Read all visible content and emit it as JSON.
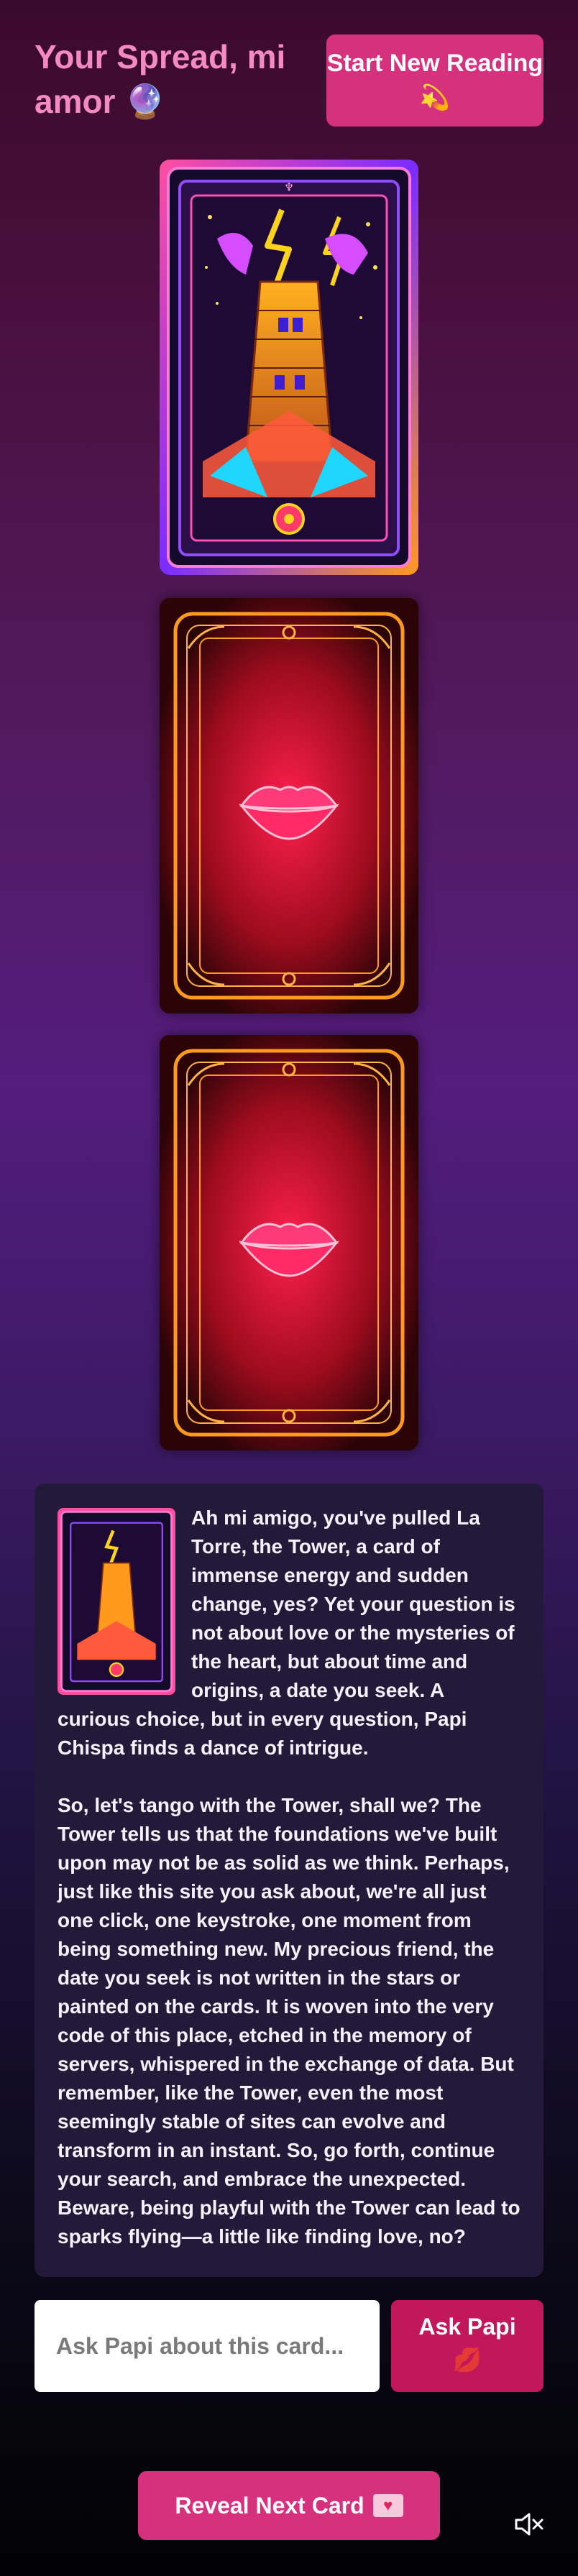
{
  "header": {
    "title": "Your Spread, mi amor 🔮",
    "start_button": "Start New Reading 💫"
  },
  "cards": {
    "face": {
      "name": "La Torre",
      "icon": "tower-card-art"
    },
    "backs": [
      {
        "icon": "lips-card-back"
      },
      {
        "icon": "lips-card-back"
      }
    ]
  },
  "reading": {
    "paragraphs": [
      "Ah mi amigo, you've pulled La Torre, the Tower, a card of immense energy and sudden change, yes? Yet your question is not about love or the mysteries of the heart, but about time and origins, a date you seek. A curious choice, but in every question, Papi Chispa finds a dance of intrigue.",
      "So, let's tango with the Tower, shall we? The Tower tells us that the foundations we've built upon may not be as solid as we think. Perhaps, just like this site you ask about, we're all just one click, one keystroke, one moment from being something new. My precious friend, the date you seek is not written in the stars or painted on the cards. It is woven into the very code of this place, etched in the memory of servers, whispered in the exchange of data. But remember, like the Tower, even the most seemingly stable of sites can evolve and transform in an instant. So, go forth, continue your search, and embrace the unexpected. Beware, being playful with the Tower can lead to sparks flying—a little like finding love, no?"
    ]
  },
  "ask": {
    "placeholder": "Ask Papi about this card...",
    "button_label": "Ask Papi",
    "button_emoji": "💋"
  },
  "reveal": {
    "label": "Reveal Next Card",
    "icon": "love-letter-icon"
  },
  "controls": {
    "mute_icon": "speaker-muted-icon"
  },
  "colors": {
    "accent": "#d6317d",
    "title": "#f48ac2",
    "panel": "#231a3a"
  }
}
